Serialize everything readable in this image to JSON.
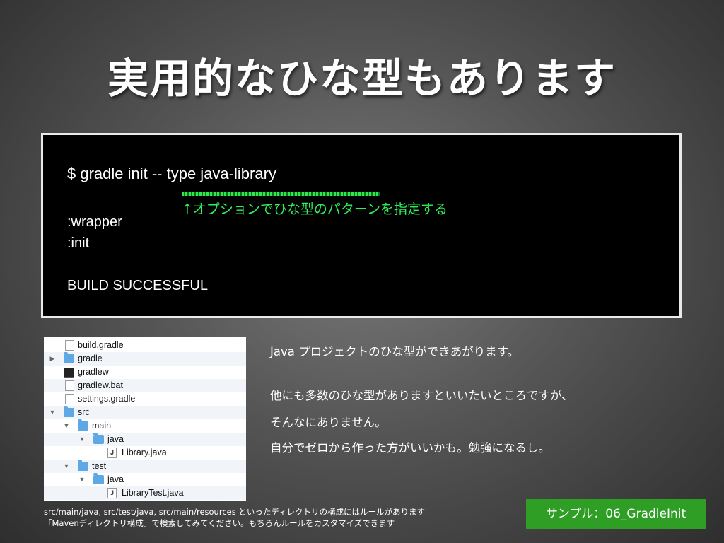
{
  "title": "実用的なひな型もあります",
  "terminal": {
    "command": "$ gradle init -- type java-library",
    "annotation": "↑オプションでひな型のパターンを指定する",
    "line_wrapper": ":wrapper",
    "line_init": ":init",
    "line_build": "BUILD SUCCESSFUL",
    "annotation_color": "#2ef05a"
  },
  "tree": [
    {
      "label": "build.gradle",
      "icon": "file-icon",
      "disclosure": ""
    },
    {
      "label": "gradle",
      "icon": "folder-icon",
      "disclosure": "▶"
    },
    {
      "label": "gradlew",
      "icon": "terminal-exec-icon",
      "disclosure": ""
    },
    {
      "label": "gradlew.bat",
      "icon": "file-icon",
      "disclosure": ""
    },
    {
      "label": "settings.gradle",
      "icon": "file-icon",
      "disclosure": ""
    },
    {
      "label": "src",
      "icon": "folder-icon",
      "disclosure": "▼"
    },
    {
      "label": "main",
      "icon": "folder-icon",
      "disclosure": "▼"
    },
    {
      "label": "java",
      "icon": "folder-icon",
      "disclosure": "▼"
    },
    {
      "label": "Library.java",
      "icon": "java-file-icon",
      "disclosure": ""
    },
    {
      "label": "test",
      "icon": "folder-icon",
      "disclosure": "▼"
    },
    {
      "label": "java",
      "icon": "folder-icon",
      "disclosure": "▼"
    },
    {
      "label": "LibraryTest.java",
      "icon": "java-file-icon",
      "disclosure": ""
    }
  ],
  "description": {
    "line1": "Java プロジェクトのひな型ができあがります。",
    "line2": "他にも多数のひな型がありますといいたいところですが、",
    "line3": "そんなにありません。",
    "line4": "自分でゼロから作った方がいいかも。勉強になるし。"
  },
  "footer": {
    "line1": "src/main/java, src/test/java, src/main/resources といったディレクトリの構成にはルールがあります",
    "line2": "「Mavenディレクトリ構成」で検索してみてください。もちろんルールをカスタマイズできます"
  },
  "sample_badge": "サンプル：06_GradleInit",
  "colors": {
    "badge": "#2f9e25",
    "terminal_bg": "#000000"
  }
}
